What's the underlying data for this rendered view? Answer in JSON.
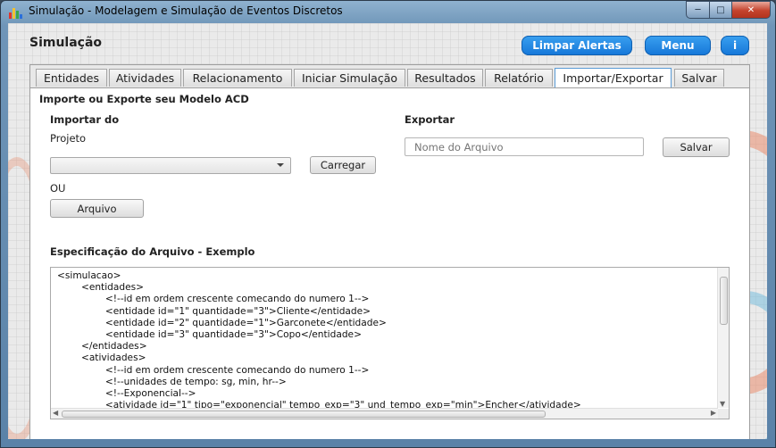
{
  "window": {
    "title": "Simulação - Modelagem e Simulação de Eventos Discretos",
    "min_glyph": "─",
    "max_glyph": "□",
    "close_glyph": "✕"
  },
  "header": {
    "title": "Simulação",
    "buttons": {
      "clear_alerts": "Limpar Alertas",
      "menu": "Menu",
      "info": "i"
    }
  },
  "tabs": [
    {
      "label": "Entidades"
    },
    {
      "label": "Atividades"
    },
    {
      "label": "Relacionamento"
    },
    {
      "label": "Iniciar Simulação"
    },
    {
      "label": "Resultados"
    },
    {
      "label": "Relatório"
    },
    {
      "label": "Importar/Exportar",
      "active": true
    },
    {
      "label": "Salvar"
    }
  ],
  "panel": {
    "heading": "Importe ou Exporte seu Modelo ACD",
    "import": {
      "title": "Importar do",
      "project_label": "Projeto",
      "project_value": "",
      "load_button": "Carregar",
      "or_label": "OU",
      "file_button": "Arquivo"
    },
    "export": {
      "title": "Exportar",
      "filename_placeholder": "Nome do Arquivo",
      "filename_value": "",
      "save_button": "Salvar"
    },
    "spec": {
      "title": "Especificação do Arquivo - Exemplo",
      "lines": [
        "<simulacao>",
        "        <entidades>",
        "                <!--id em ordem crescente comecando do numero 1-->",
        "                <entidade id=\"1\" quantidade=\"3\">Cliente</entidade>",
        "                <entidade id=\"2\" quantidade=\"1\">Garconete</entidade>",
        "                <entidade id=\"3\" quantidade=\"3\">Copo</entidade>",
        "        </entidades>",
        "        <atividades>",
        "                <!--id em ordem crescente comecando do numero 1-->",
        "                <!--unidades de tempo: sg, min, hr-->",
        "                <!--Exponencial-->",
        "                <atividade id=\"1\" tipo=\"exponencial\" tempo_exp=\"3\" und_tempo_exp=\"min\">Encher</atividade>"
      ]
    }
  },
  "colors": {
    "accent_button": "#1f86e6",
    "active_tab_border": "#5a9bd5",
    "close_button": "#c4432d"
  }
}
